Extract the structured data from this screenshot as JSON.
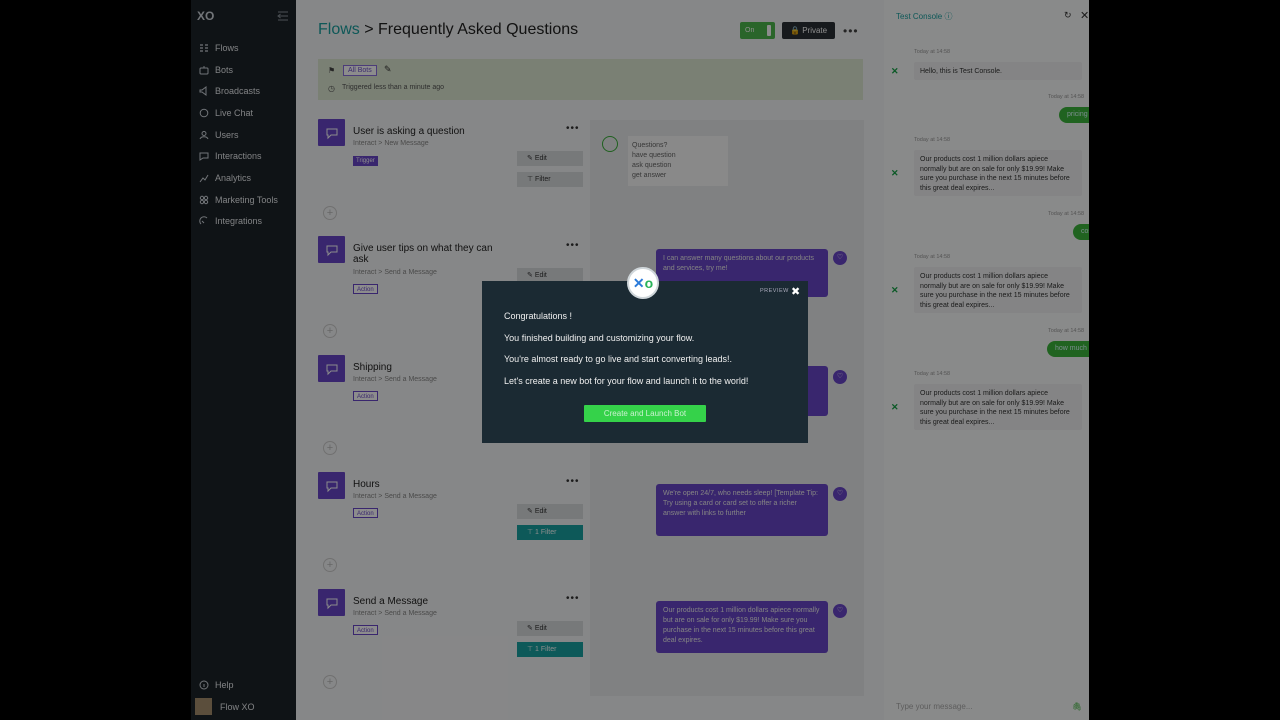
{
  "sidebar": {
    "logo": "XO",
    "items": [
      {
        "label": "Flows",
        "icon": "flows-icon"
      },
      {
        "label": "Bots",
        "icon": "bots-icon"
      },
      {
        "label": "Broadcasts",
        "icon": "broadcast-icon"
      },
      {
        "label": "Live Chat",
        "icon": "chat-icon"
      },
      {
        "label": "Users",
        "icon": "users-icon"
      },
      {
        "label": "Interactions",
        "icon": "interactions-icon"
      },
      {
        "label": "Analytics",
        "icon": "analytics-icon"
      },
      {
        "label": "Marketing Tools",
        "icon": "marketing-icon"
      },
      {
        "label": "Integrations",
        "icon": "integrations-icon"
      }
    ],
    "help": "Help",
    "account": "Flow XO"
  },
  "header": {
    "root": "Flows",
    "separator": ">",
    "title": "Frequently Asked Questions",
    "toggle": "On",
    "private": "Private"
  },
  "trigger_bar": {
    "bots_tag": "All Bots",
    "triggered": "Triggered less than a minute ago"
  },
  "nodes": [
    {
      "title": "User is asking a question",
      "sub": "Interact > New Message",
      "tag": "Trigger",
      "edit": "Edit",
      "filter": "Filter"
    },
    {
      "title": "Give user tips on what they can ask",
      "sub": "Interact > Send a Message",
      "tag": "Action",
      "edit": "Edit"
    },
    {
      "title": "Shipping",
      "sub": "Interact > Send a Message",
      "tag": "Action"
    },
    {
      "title": "Hours",
      "sub": "Interact > Send a Message",
      "tag": "Action",
      "edit": "Edit",
      "filter": "1 Filter"
    },
    {
      "title": "Send a Message",
      "sub": "Interact > Send a Message",
      "tag": "Action",
      "edit": "Edit",
      "filter": "1 Filter"
    }
  ],
  "previews": {
    "question_lines": [
      "Questions?",
      "have question",
      "ask question",
      "get answer"
    ],
    "tips": "I can answer many questions about our products and services, try me!",
    "hours": "We're open 24/7, who needs sleep! [Template Tip: Try using a card or card set to offer a richer answer with links to further",
    "send": "Our products cost 1 million dollars apiece normally but are on sale for only $19.99! Make sure you purchase in the next 15 minutes before this great deal expires."
  },
  "console": {
    "title": "Test Console",
    "input_placeholder": "Type your message...",
    "messages": [
      {
        "from": "bot",
        "time": "Today at 14:58",
        "text": "Hello, this is Test Console."
      },
      {
        "from": "user",
        "time": "Today at 14:58",
        "text": "pricing"
      },
      {
        "from": "bot",
        "time": "Today at 14:58",
        "text": "Our products cost 1 million dollars apiece normally but are on sale for only $19.99! Make sure you purchase in the next 15 minutes before this great deal expires..."
      },
      {
        "from": "user",
        "time": "Today at 14:58",
        "text": "cost"
      },
      {
        "from": "bot",
        "time": "Today at 14:58",
        "text": "Our products cost 1 million dollars apiece normally but are on sale for only $19.99! Make sure you purchase in the next 15 minutes before this great deal expires..."
      },
      {
        "from": "user",
        "time": "Today at 14:58",
        "text": "how much"
      },
      {
        "from": "bot",
        "time": "Today at 14:58",
        "text": "Our products cost 1 million dollars apiece normally but are on sale for only $19.99! Make sure you purchase in the next 15 minutes before this great deal expires..."
      }
    ]
  },
  "modal": {
    "preview_label": "PREVIEW",
    "lines": [
      "Congratulations !",
      "You finished building and customizing your flow.",
      "You're almost ready to go live and start converting leads!.",
      "Let's create a new bot for your flow and launch it to the world!"
    ],
    "cta": "Create and Launch Bot"
  },
  "colors": {
    "accent_purple": "#6946c8",
    "teal": "#1aa0a0",
    "green": "#35d24a",
    "modal_bg": "#1b2a33",
    "sidebar_bg": "#1d2329"
  }
}
